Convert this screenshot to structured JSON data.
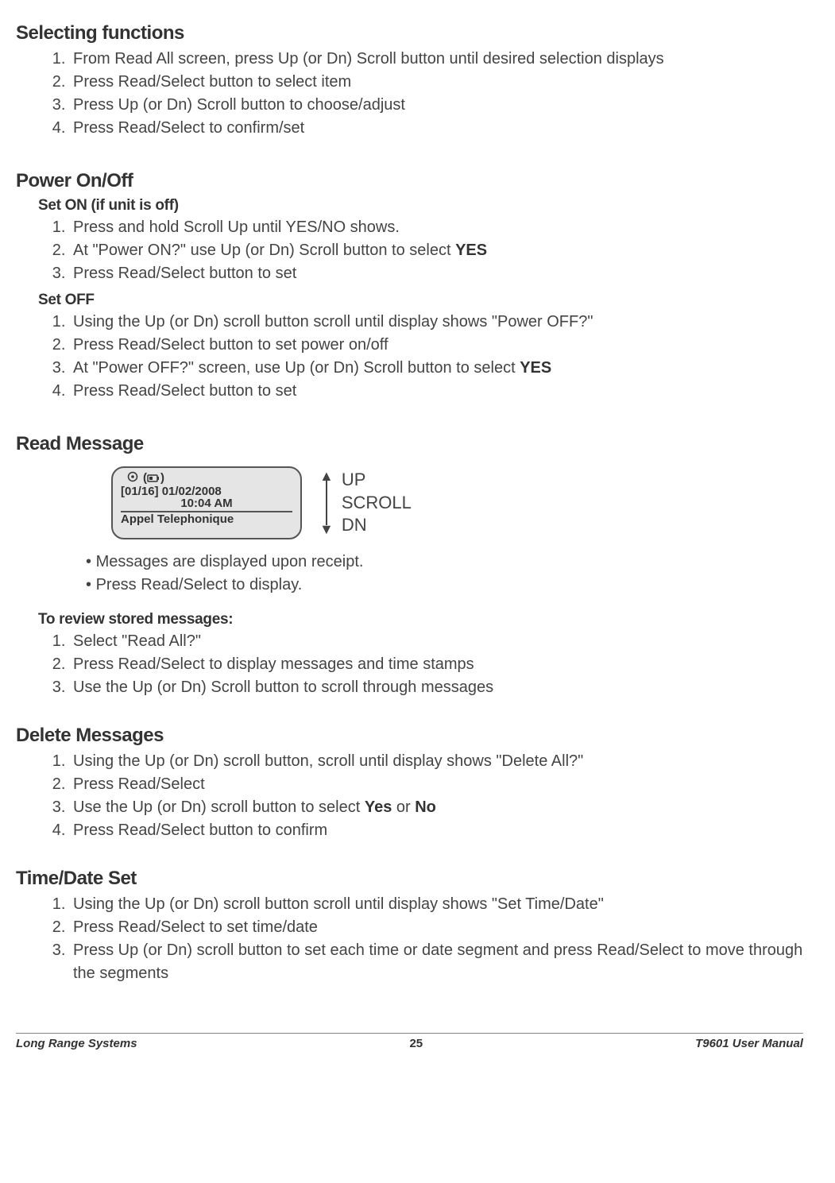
{
  "sections": {
    "selecting": {
      "title": "Selecting functions",
      "steps": [
        "From Read All screen, press Up (or Dn) Scroll button until desired selection displays",
        "Press Read/Select button to select item",
        "Press Up (or Dn) Scroll button to choose/adjust",
        "Press Read/Select to confirm/set"
      ]
    },
    "power": {
      "title": "Power On/Off",
      "on": {
        "sub": "Set ON (if unit is off)",
        "steps_pre": [
          "Press and hold Scroll Up until YES/NO shows."
        ],
        "step2_pre": "At \"Power ON?\" use Up (or Dn) Scroll button to select ",
        "step2_bold": "YES",
        "steps_post": [
          "Press Read/Select button to set"
        ]
      },
      "off": {
        "sub": "Set OFF",
        "steps_pre": [
          "Using the Up (or Dn) scroll button scroll until display shows \"Power OFF?\"",
          "Press Read/Select button to set power on/off"
        ],
        "step3_pre": "At \"Power OFF?\" screen, use Up (or Dn) Scroll button to select ",
        "step3_bold": "YES",
        "steps_post": [
          "Press Read/Select button to set"
        ]
      }
    },
    "read": {
      "title": "Read Message",
      "lcd": {
        "count": "[01/16]",
        "date": "01/02/2008",
        "time": "10:04 AM",
        "msg": "Appel Telephonique"
      },
      "arrow_labels": {
        "up": "UP",
        "scroll": "SCROLL",
        "dn": "DN"
      },
      "bullets": [
        "Messages are displayed upon receipt.",
        "Press Read/Select to display."
      ],
      "stored": {
        "sub": "To review stored messages:",
        "steps": [
          "Select \"Read All?\"",
          "Press Read/Select to display messages and time stamps",
          "Use the Up (or Dn) Scroll button to scroll through messages"
        ]
      }
    },
    "delete": {
      "title": "Delete Messages",
      "step1": "Using the Up (or Dn) scroll button, scroll until display shows \"Delete All?\"",
      "step2": "Press Read/Select",
      "step3_pre": "Use the Up (or Dn) scroll button to select ",
      "step3_yes": "Yes",
      "step3_mid": " or ",
      "step3_no": "No",
      "step4": "Press Read/Select button to confirm"
    },
    "time": {
      "title": "Time/Date Set",
      "steps": [
        "Using the Up (or Dn) scroll button scroll until display shows \"Set Time/Date\"",
        "Press Read/Select to set time/date",
        "Press Up (or Dn) scroll button to set each time or date segment and press Read/Select to move through the segments"
      ]
    }
  },
  "footer": {
    "left": "Long Range Systems",
    "center": "25",
    "right": "T9601 User Manual"
  }
}
